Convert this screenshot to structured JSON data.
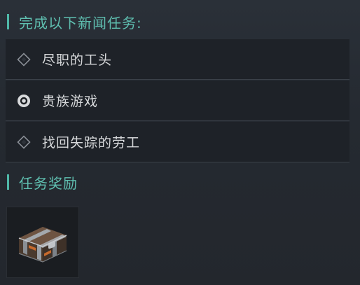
{
  "tasks_section": {
    "title": "完成以下新闻任务:",
    "tasks": [
      {
        "label": "尽职的工头",
        "state": "pending",
        "icon": "diamond-icon"
      },
      {
        "label": "贵族游戏",
        "state": "active",
        "icon": "radio-dot-icon"
      },
      {
        "label": "找回失踪的劳工",
        "state": "pending",
        "icon": "diamond-icon"
      }
    ]
  },
  "rewards_section": {
    "title": "任务奖励",
    "items": [
      {
        "icon": "treasure-chest-icon"
      }
    ]
  },
  "colors": {
    "accent": "#4fb8a8",
    "text": "#d6d8da",
    "row_bg": "#1e2228"
  }
}
